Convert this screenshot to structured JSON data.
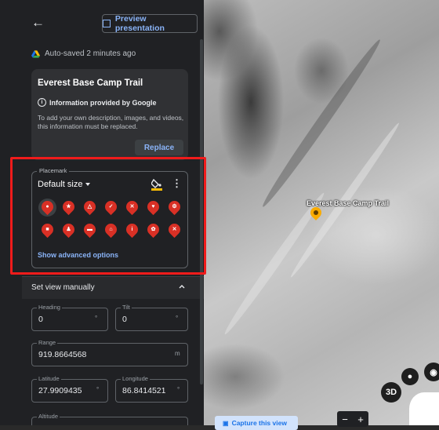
{
  "header": {
    "back_icon": "arrow-back-icon",
    "preview_label": "Preview presentation"
  },
  "autosave": {
    "text": "Auto-saved 2 minutes ago"
  },
  "card": {
    "title": "Everest Base Camp Trail",
    "info": "Information provided by Google",
    "description": "To add your own description, images, and videos, this information must be replaced.",
    "replace_label": "Replace"
  },
  "placemark": {
    "legend": "Placemark",
    "size": "Default size",
    "icons_row1": [
      "dot",
      "star",
      "warning",
      "check",
      "restaurant",
      "heart",
      "hiking"
    ],
    "icons_row2": [
      "hotel",
      "person",
      "bed",
      "home",
      "info",
      "flower",
      "close"
    ],
    "advanced_label": "Show advanced options",
    "accent": "#d93025"
  },
  "view": {
    "section_label": "Set view manually",
    "heading": {
      "label": "Heading",
      "value": "0",
      "unit": "°"
    },
    "tilt": {
      "label": "Tilt",
      "value": "0",
      "unit": "°"
    },
    "range": {
      "label": "Range",
      "value": "919.8664568",
      "unit": "m"
    },
    "latitude": {
      "label": "Latitude",
      "value": "27.9909435",
      "unit": "°"
    },
    "longitude": {
      "label": "Longitude",
      "value": "86.8414521",
      "unit": "°"
    },
    "altitude": {
      "label": "Altitude"
    }
  },
  "map": {
    "marker_label": "Everest Base Camp Trail",
    "capture_label": "Capture this view",
    "btn_3d": "3D",
    "zoom_minus": "−",
    "zoom_plus": "+"
  }
}
